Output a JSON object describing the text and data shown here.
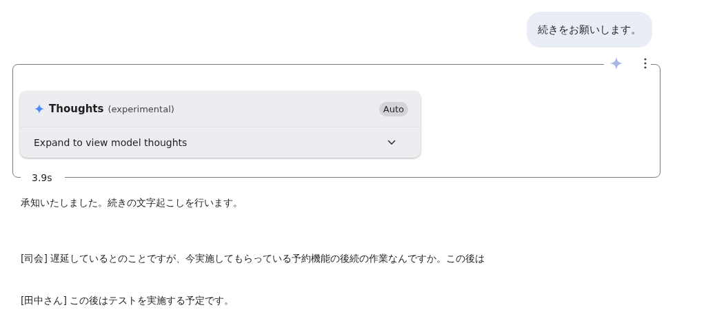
{
  "user_message": {
    "text": "続きをお願いします。"
  },
  "response": {
    "thoughts": {
      "title": "Thoughts",
      "subtitle": "(experimental)",
      "mode_badge": "Auto",
      "summary": "Expand to view model thoughts",
      "expanded": false
    },
    "duration": "3.9s"
  },
  "paragraphs": [
    "承知いたしました。続きの文字起こしを行います。",
    "[司会] 遅延しているとのことですが、今実施してもらっている予約機能の後続の作業なんですか。この後は",
    "[田中さん] この後はテストを実施する予定です。"
  ]
}
